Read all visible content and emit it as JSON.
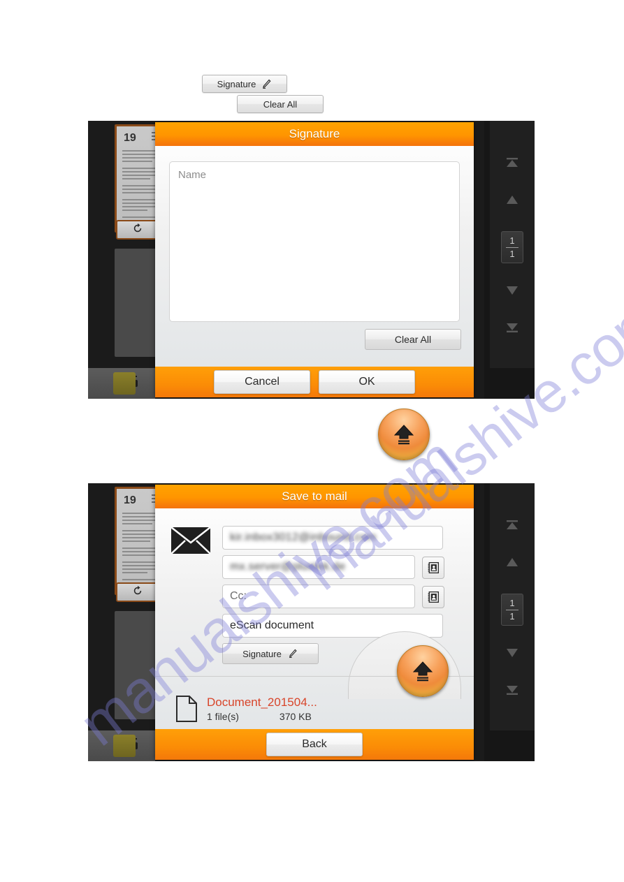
{
  "watermark": {
    "text": "manualshive.com"
  },
  "stray_buttons": {
    "signature_label": "Signature",
    "clear_all_label": "Clear All"
  },
  "screen_1": {
    "dialog": {
      "title": "Signature",
      "canvas_placeholder": "Name",
      "clear_all_label": "Clear All",
      "cancel_label": "Cancel",
      "ok_label": "OK"
    },
    "left_rail": {
      "thumbnail_page_number": "19",
      "rotate_icon": "rotate-icon",
      "printer_icon": "printer-add-icon"
    },
    "right_rail": {
      "first_page_icon": "first-page-icon",
      "prev_page_icon": "up-arrow-icon",
      "next_page_icon": "down-arrow-icon",
      "last_page_icon": "last-page-icon",
      "current_page": "1",
      "total_pages": "1"
    }
  },
  "send_button": {
    "icon": "upload-arrow-icon"
  },
  "screen_2": {
    "dialog": {
      "title": "Save to mail",
      "envelope_icon": "envelope-icon",
      "fields": {
        "from_value": "kir.inbox3012@inbound.com",
        "to_value": "mx.server@plustek.de",
        "cc_placeholder": "Cc:",
        "subject_value": "eScan document"
      },
      "address_book_icon": "address-book-icon",
      "signature_label": "Signature",
      "attachment": {
        "file_icon": "document-icon",
        "name": "Document_201504...",
        "count": "1 file(s)",
        "size": "370 KB"
      },
      "back_label": "Back"
    },
    "left_rail": {
      "thumbnail_page_number": "19",
      "rotate_icon": "rotate-icon",
      "printer_icon": "printer-add-icon"
    },
    "right_rail": {
      "current_page": "1",
      "total_pages": "1"
    }
  },
  "colors": {
    "accent_orange": "#FF9500",
    "footer_orange": "#FB8C06",
    "file_red": "#D8452A",
    "watermark": "#7E7ED8"
  }
}
